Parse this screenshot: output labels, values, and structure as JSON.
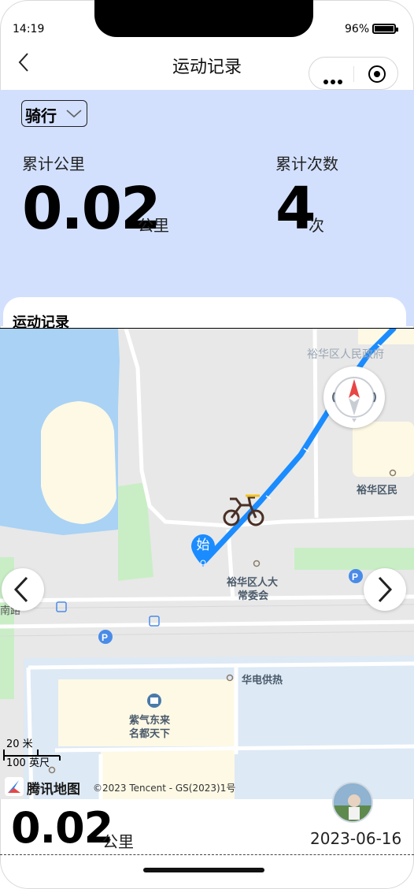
{
  "status_bar": {
    "time": "14:19",
    "battery": "96%"
  },
  "nav": {
    "title": "运动记录"
  },
  "summary": {
    "sport_type": "骑行",
    "total_distance_label": "累计公里",
    "total_distance_value": "0.02",
    "total_distance_unit": "公里",
    "total_count_label": "累计次数",
    "total_count_value": "4",
    "total_count_unit": "次"
  },
  "record": {
    "title": "运动记录"
  },
  "map": {
    "labels": {
      "gov": "裕华区人民政府",
      "gov2": "裕华区民",
      "npc_line1": "裕华区人大",
      "npc_line2": "常委会",
      "heat": "华电供热",
      "estate_line1": "紫气东来",
      "estate_line2": "名都天下",
      "road_left": "南路"
    },
    "start_marker": "始",
    "scale_metric": "20 米",
    "scale_imperial": "100 英尺",
    "logo": "腾讯地图",
    "copyright": "©2023 Tencent - GS(2023)1号",
    "route_color": "#1a8cff"
  },
  "entry": {
    "distance": "0.02",
    "unit": "公里",
    "date": "2023-06-16"
  }
}
